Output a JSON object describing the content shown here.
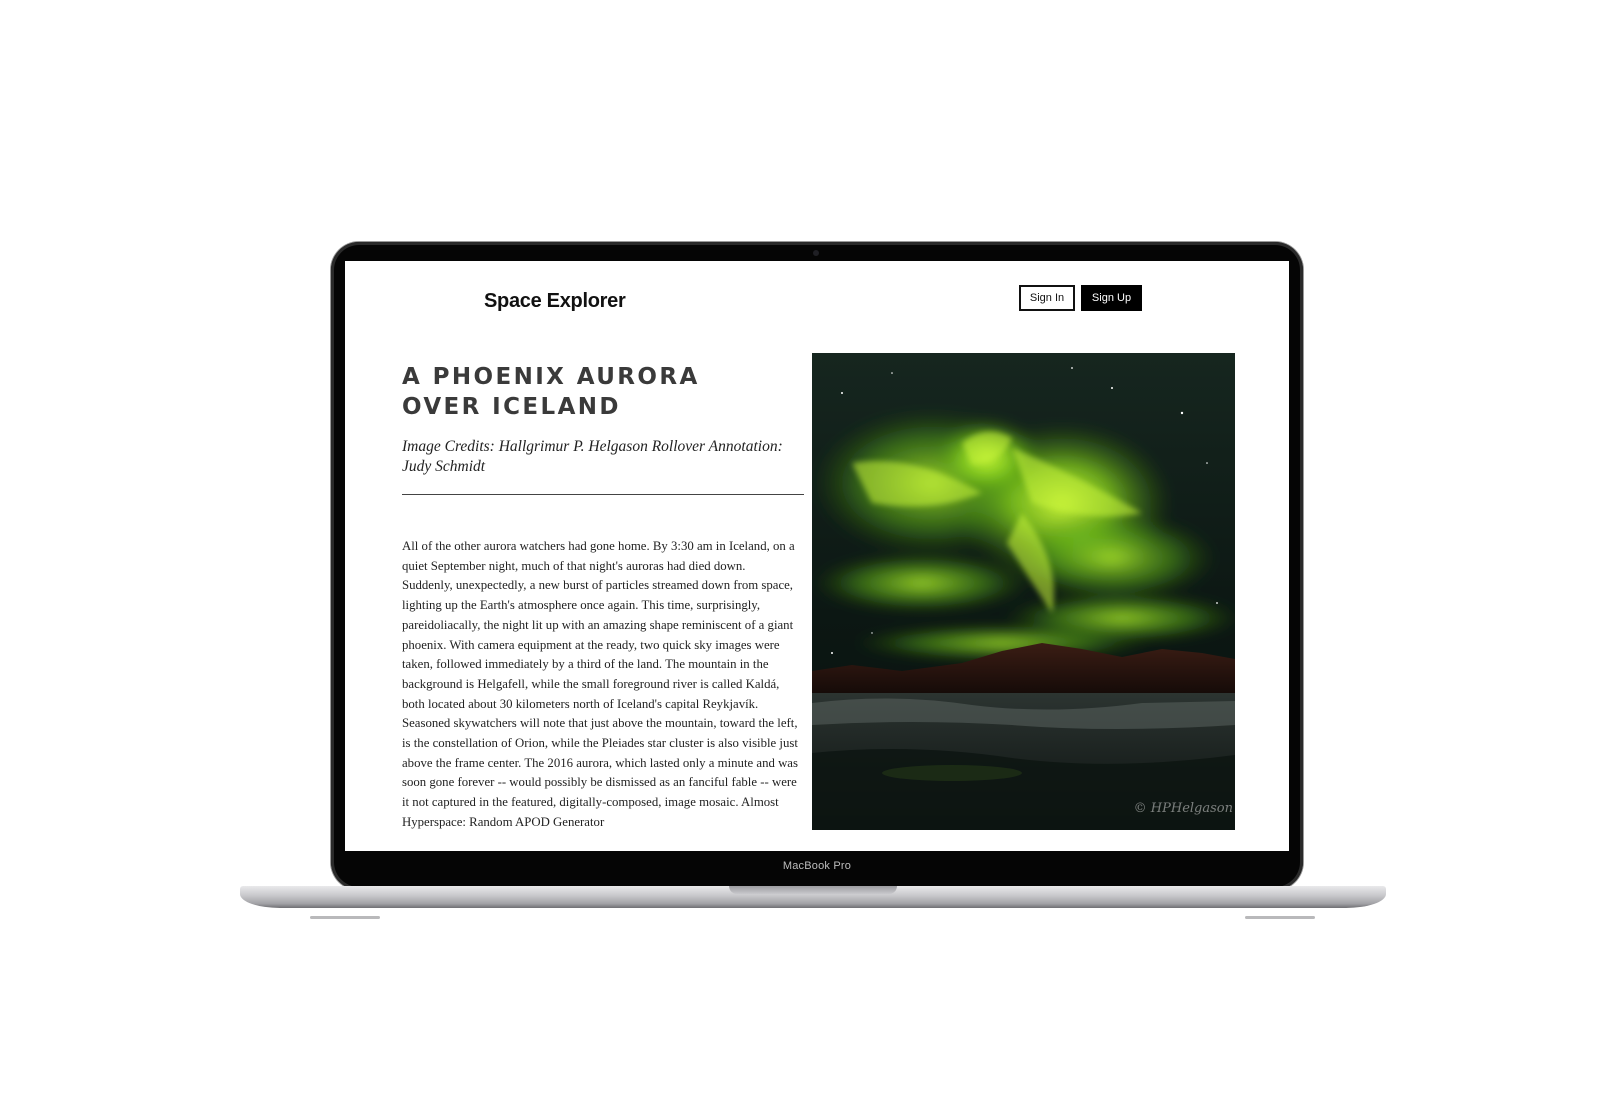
{
  "device": {
    "label": "MacBook Pro"
  },
  "header": {
    "site_title": "Space Explorer",
    "sign_in_label": "Sign In",
    "sign_up_label": "Sign Up"
  },
  "article": {
    "title": "A PHOENIX AURORA OVER ICELAND",
    "credits": "Image Credits: Hallgrimur P. Helgason Rollover Annotation: Judy Schmidt",
    "body": "All of the other aurora watchers had gone home. By 3:30 am in Iceland, on a quiet September night, much of that night's auroras had died down. Suddenly, unexpectedly, a new burst of particles streamed down from space, lighting up the Earth's atmosphere once again. This time, surprisingly, pareidoliacally, the night lit up with an amazing shape reminiscent of a giant phoenix. With camera equipment at the ready, two quick sky images were taken, followed immediately by a third of the land. The mountain in the background is Helgafell, while the small foreground river is called Kaldá, both located about 30 kilometers north of Iceland's capital Reykjavík. Seasoned skywatchers will note that just above the mountain, toward the left, is the constellation of Orion, while the Pleiades star cluster is also visible just above the frame center. The 2016 aurora, which lasted only a minute and was soon gone forever -- would possibly be dismissed as an fanciful fable -- were it not captured in the featured, digitally-composed, image mosaic. Almost Hyperspace: Random APOD Generator",
    "image_watermark": "© HPHelgason"
  },
  "colors": {
    "aurora_green": "#9be22b",
    "night_sky": "#0b1411",
    "button_dark": "#000000"
  }
}
